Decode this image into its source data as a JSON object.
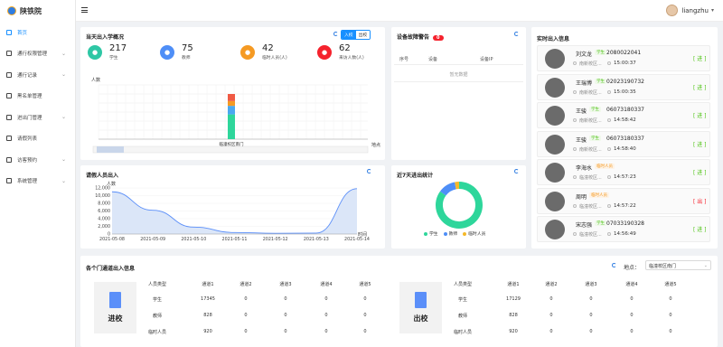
{
  "app": {
    "name": "陕铁院"
  },
  "user": {
    "name": "liangzhu"
  },
  "sidebar": {
    "items": [
      {
        "label": "首页",
        "active": true,
        "caret": false
      },
      {
        "label": "通行权限管理",
        "caret": true
      },
      {
        "label": "通行记录",
        "caret": true
      },
      {
        "label": "黑名单管理",
        "caret": false
      },
      {
        "label": "进出门管理",
        "caret": true
      },
      {
        "label": "请假列表",
        "caret": false
      },
      {
        "label": "访客预约",
        "caret": true
      },
      {
        "label": "系统管理",
        "caret": true
      }
    ]
  },
  "overview": {
    "title": "当天出入学概况",
    "toggle": [
      "入校",
      "出校"
    ],
    "stats": [
      {
        "value": "217",
        "label": "学生",
        "color": "#2ec7a5",
        "icon": "student-icon"
      },
      {
        "value": "75",
        "label": "教师",
        "color": "#4e8ef7",
        "icon": "teacher-icon"
      },
      {
        "value": "42",
        "label": "临时人员(人)",
        "color": "#f59a23",
        "icon": "temp-person-icon"
      },
      {
        "value": "62",
        "label": "来访人数(人)",
        "color": "#f5222d",
        "icon": "visitor-icon"
      }
    ]
  },
  "bar_chart": {
    "ylabel": "人数",
    "xlabel": "地点",
    "categories": [
      "临潼校区南门"
    ],
    "stack": [
      {
        "name": "学生",
        "value": 217,
        "color": "#2ed69b"
      },
      {
        "name": "教师",
        "value": 75,
        "color": "#4aa8f0"
      },
      {
        "name": "临时人员",
        "value": 42,
        "color": "#f59a23"
      },
      {
        "name": "来访",
        "value": 62,
        "color": "#f05a44"
      }
    ]
  },
  "alarm": {
    "title": "设备故障警告",
    "count": "0",
    "columns": [
      "序号",
      "设备",
      "设备IP"
    ],
    "empty": "暂无数据"
  },
  "leave": {
    "title": "请假人员出入",
    "ylabel": "人数",
    "xlabel": "时间"
  },
  "chart_data": [
    {
      "type": "bar",
      "title": "当天出入学概况",
      "categories": [
        "临潼校区南门"
      ],
      "series": [
        {
          "name": "学生",
          "values": [
            217
          ]
        },
        {
          "name": "教师",
          "values": [
            75
          ]
        },
        {
          "name": "临时人员(人)",
          "values": [
            42
          ]
        },
        {
          "name": "来访人数(人)",
          "values": [
            62
          ]
        }
      ],
      "xlabel": "地点",
      "ylabel": "人数"
    },
    {
      "type": "area",
      "title": "请假人员出入",
      "x": [
        "2021-05-08",
        "2021-05-09",
        "2021-05-10",
        "2021-05-11",
        "2021-05-12",
        "2021-05-13",
        "2021-05-14"
      ],
      "series": [
        {
          "values": [
            11000,
            6200,
            1800,
            400,
            200,
            250,
            11800
          ]
        }
      ],
      "ylim": [
        0,
        12000
      ],
      "yticks": [
        "12,000",
        "10,000",
        "8,000",
        "6,000",
        "4,000",
        "2,000",
        "0"
      ],
      "xlabel": "时间",
      "ylabel": "人数"
    },
    {
      "type": "pie",
      "title": "近7天进出统计",
      "series": [
        {
          "name": "学生",
          "value": 85,
          "color": "#2ed69b"
        },
        {
          "name": "教师",
          "value": 12,
          "color": "#4e8ef7"
        },
        {
          "name": "临时人员",
          "value": 3,
          "color": "#f5b829"
        }
      ]
    }
  ],
  "weekly": {
    "title": "近7天进出统计",
    "legend": [
      {
        "name": "学生",
        "color": "#2ed69b"
      },
      {
        "name": "教师",
        "color": "#4e8ef7"
      },
      {
        "name": "临时人员",
        "color": "#f5b829"
      }
    ]
  },
  "realtime": {
    "title": "实时出入信息",
    "people": [
      {
        "name": "刘文龙",
        "tag": "学生",
        "tagType": "stu",
        "phone": "2080022041",
        "loc": "南新校区...",
        "time": "15:00:37",
        "dir": "[ 进 ]",
        "dirColor": "#52c41a"
      },
      {
        "name": "王瑞博",
        "tag": "学生",
        "tagType": "stu",
        "phone": "02023190732",
        "loc": "南新校区...",
        "time": "15:00:35",
        "dir": "[ 进 ]",
        "dirColor": "#52c41a"
      },
      {
        "name": "王骏",
        "tag": "学生",
        "tagType": "stu",
        "phone": "06073180337",
        "loc": "南新校区...",
        "time": "14:58:42",
        "dir": "[ 进 ]",
        "dirColor": "#52c41a"
      },
      {
        "name": "王骏",
        "tag": "学生",
        "tagType": "stu",
        "phone": "06073180337",
        "loc": "南新校区...",
        "time": "14:58:40",
        "dir": "[ 进 ]",
        "dirColor": "#52c41a"
      },
      {
        "name": "李海水",
        "tag": "临时人员",
        "tagType": "tmp",
        "phone": "",
        "loc": "临潼校区...",
        "time": "14:57:23",
        "dir": "[ 进 ]",
        "dirColor": "#52c41a"
      },
      {
        "name": "周明",
        "tag": "临时人员",
        "tagType": "tmp",
        "phone": "",
        "loc": "临潼校区...",
        "time": "14:57:22",
        "dir": "[ 出 ]",
        "dirColor": "#f5222d"
      },
      {
        "name": "宋志强",
        "tag": "学生",
        "tagType": "stu",
        "phone": "07033190328",
        "loc": "临潼校区...",
        "time": "14:56:49",
        "dir": "[ 进 ]",
        "dirColor": "#52c41a"
      }
    ]
  },
  "gates": {
    "title": "各个门通道出入信息",
    "location_label": "地点：",
    "location_value": "临潼校区南门",
    "columns": [
      "人员类型",
      "通道1",
      "通道2",
      "通道3",
      "通道4",
      "通道5"
    ],
    "in": {
      "label": "进校",
      "rows": [
        [
          "学生",
          "17345",
          "0",
          "0",
          "0",
          "0"
        ],
        [
          "教师",
          "828",
          "0",
          "0",
          "0",
          "0"
        ],
        [
          "临时人员",
          "920",
          "0",
          "0",
          "0",
          "0"
        ]
      ]
    },
    "out": {
      "label": "出校",
      "rows": [
        [
          "学生",
          "17129",
          "0",
          "0",
          "0",
          "0"
        ],
        [
          "教师",
          "828",
          "0",
          "0",
          "0",
          "0"
        ],
        [
          "临时人员",
          "920",
          "0",
          "0",
          "0",
          "0"
        ]
      ]
    }
  }
}
